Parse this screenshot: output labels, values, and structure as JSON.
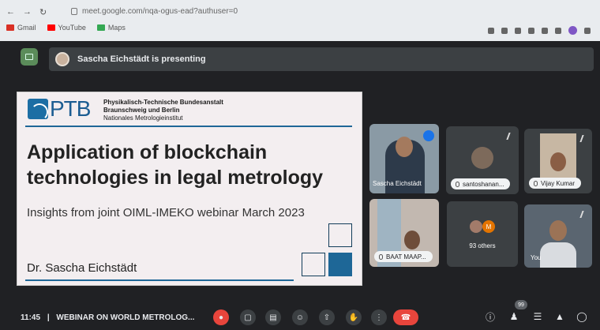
{
  "browser": {
    "url": "meet.google.com/nqa-ogus-ead?authuser=0",
    "bookmarks": [
      {
        "label": "Gmail",
        "color": "#d93025"
      },
      {
        "label": "YouTube",
        "color": "#ff0000"
      },
      {
        "label": "Maps",
        "color": "#34a853"
      }
    ]
  },
  "meet": {
    "presenting_text": "Sascha Eichstädt is presenting"
  },
  "slide": {
    "logo_text": "PTB",
    "institution": [
      "Physikalisch-Technische Bundesanstalt",
      "Braunschweig und Berlin",
      "Nationales Metrologieinstitut"
    ],
    "title_line1": "Application of blockchain",
    "title_line2": "technologies in legal metrology",
    "subtitle": "Insights from joint OIML-IMEKO webinar March 2023",
    "author": "Dr. Sascha Eichstädt"
  },
  "tiles": {
    "presenter": {
      "name": "Sascha Eichstädt"
    },
    "santosh": {
      "name": "santoshanan..."
    },
    "vijay": {
      "name": "Vijay Kumar"
    },
    "baat": {
      "name": "BAAT MAAP..."
    },
    "others": {
      "avatar_letter": "M",
      "label": "93 others"
    },
    "you": {
      "label": "You"
    }
  },
  "bottom": {
    "time": "11:45",
    "separator": "|",
    "meeting_name": "WEBINAR ON WORLD METROLOG...",
    "participant_count": "99"
  }
}
